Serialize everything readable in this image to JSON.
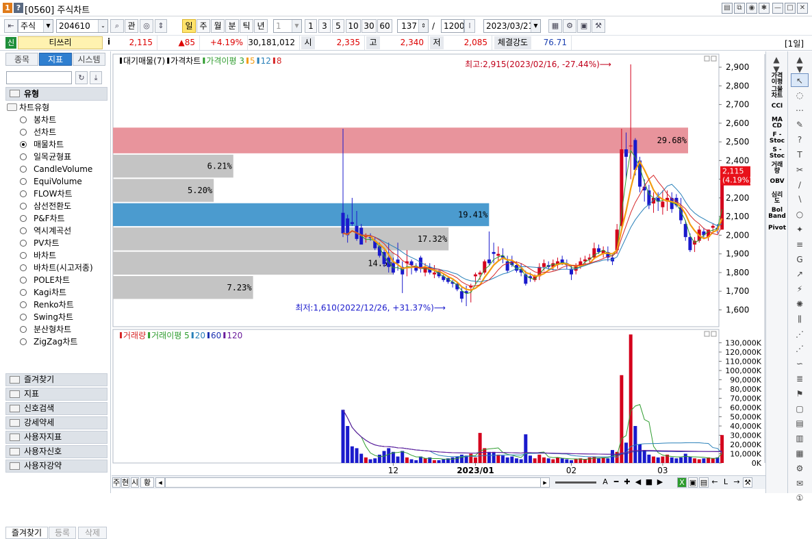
{
  "window": {
    "num": "1",
    "help": "?",
    "title": "[0560] 주식차트",
    "controls": [
      "☐",
      "☐",
      "⚙",
      "—",
      "□",
      "✕"
    ]
  },
  "toolbar": {
    "market": "주식",
    "code": "204610",
    "btn_gwan": "관",
    "periods": [
      "일",
      "주",
      "월",
      "분",
      "틱",
      "년"
    ],
    "active_period": "일",
    "n_value": "1",
    "nums": [
      "1",
      "3",
      "5",
      "10",
      "30",
      "60"
    ],
    "count": "137",
    "total": "1200",
    "date": "2023/03/21"
  },
  "quote": {
    "badge": "신",
    "name": "티쓰리",
    "info": "i",
    "price": "2,115",
    "change": "▲85",
    "pct": "+4.19%",
    "volume": "30,181,012",
    "open_label": "시",
    "open": "2,335",
    "high_label": "고",
    "high": "2,340",
    "low_label": "저",
    "low": "2,085",
    "strength_label": "체결강도",
    "strength": "76.71",
    "period_tag": "[1일]"
  },
  "sidebar": {
    "tabs": [
      "종목",
      "지표",
      "시스템"
    ],
    "active_tab": "지표",
    "section": "유형",
    "group": "차트유형",
    "items": [
      "봉차트",
      "선차트",
      "매물차트",
      "일목균형표",
      "CandleVolume",
      "EquiVolume",
      "FLOW차트",
      "삼선전환도",
      "P&F차트",
      "역시계곡선",
      "PV차트",
      "바차트",
      "바차트(시고저종)",
      "POLE차트",
      "Kagi차트",
      "Renko차트",
      "Swing차트",
      "분산형차트",
      "ZigZag차트"
    ],
    "selected": "매물차트",
    "accordion": [
      "즐겨찾기",
      "지표",
      "신호검색",
      "강세약세",
      "사용자지표",
      "사용자신호",
      "사용자강약"
    ],
    "bottom_tabs": [
      "즐겨찾기",
      "등록",
      "삭제"
    ]
  },
  "chart": {
    "legend_upper": [
      {
        "t": "대기매물(7)",
        "c": "#000"
      },
      {
        "t": "가격차트",
        "c": "#000"
      },
      {
        "t": "가격이평 3",
        "c": "#2e9c2e"
      },
      {
        "t": "5",
        "c": "#f39c12"
      },
      {
        "t": "12",
        "c": "#2980b9"
      },
      {
        "t": "8",
        "c": "#d62728"
      }
    ],
    "legend_lower": [
      {
        "t": "거래량",
        "c": "#d62728"
      },
      {
        "t": "거래이평 5",
        "c": "#2e9c2e"
      },
      {
        "t": "20",
        "c": "#2980b9"
      },
      {
        "t": "60",
        "c": "#1a2fb0"
      },
      {
        "t": "120",
        "c": "#6a1b9a"
      }
    ],
    "high_annot": "최고:2,915(2023/02/16, -27.44%)⟶",
    "low_annot": "최저:1,610(2022/12/26, +31.37%)⟶",
    "last_price": "2,115",
    "last_pct": "(4.19%)",
    "price_ticks": [
      "2,900",
      "2,800",
      "2,700",
      "2,600",
      "2,500",
      "2,400",
      "2,300",
      "2,200",
      "2,100",
      "2,000",
      "1,900",
      "1,800",
      "1,700",
      "1,600"
    ],
    "vol_ticks": [
      "130,000K",
      "120,000K",
      "110,000K",
      "100,000K",
      "90,000K",
      "80,000K",
      "70,000K",
      "60,000K",
      "50,000K",
      "40,000K",
      "30,000K",
      "20,000K",
      "10,000K",
      "0K"
    ],
    "x_ticks": [
      "12",
      "2023/01",
      "02",
      "03"
    ]
  },
  "chart_data": {
    "type": "candlestick",
    "price_range": [
      1510,
      2970
    ],
    "volume_range": [
      0,
      140000
    ],
    "volume_unit": "K",
    "volume_profile": [
      {
        "pct": "29.68%",
        "from": 2435,
        "to": 2580,
        "color": "#e8949c"
      },
      {
        "pct": "6.21%",
        "from": 2305,
        "to": 2435,
        "color": "#c4c4c4"
      },
      {
        "pct": "5.20%",
        "from": 2175,
        "to": 2305,
        "color": "#c4c4c4"
      },
      {
        "pct": "19.41%",
        "from": 2045,
        "to": 2175,
        "color": "#4b9bcf"
      },
      {
        "pct": "17.32%",
        "from": 1915,
        "to": 2045,
        "color": "#c4c4c4"
      },
      {
        "pct": "14.5%",
        "from": 1785,
        "to": 1915,
        "color": "#c4c4c4"
      },
      {
        "pct": "7.23%",
        "from": 1655,
        "to": 1785,
        "color": "#c4c4c4"
      }
    ],
    "volume_profile_share": [
      29.68,
      6.21,
      5.2,
      19.41,
      17.32,
      14.5,
      7.23
    ],
    "candles": [
      [
        2120,
        2570,
        1990,
        2010,
        57500
      ],
      [
        2090,
        2110,
        1960,
        2000,
        40000
      ],
      [
        2070,
        2200,
        2050,
        2060,
        18000
      ],
      [
        2050,
        2130,
        1970,
        1980,
        16000
      ],
      [
        2040,
        2060,
        1950,
        1950,
        10000
      ],
      [
        1990,
        2010,
        1960,
        2000,
        6000
      ],
      [
        1990,
        2010,
        1970,
        1985,
        4000
      ],
      [
        1970,
        1990,
        1920,
        1930,
        5000
      ],
      [
        1940,
        1960,
        1880,
        1890,
        9000
      ],
      [
        1910,
        1920,
        1830,
        1845,
        13000
      ],
      [
        1880,
        1960,
        1800,
        1830,
        16000
      ],
      [
        1850,
        1880,
        1790,
        1800,
        12000
      ],
      [
        1870,
        1960,
        1810,
        1850,
        7000
      ],
      [
        1830,
        1860,
        1690,
        1790,
        13000
      ],
      [
        1850,
        1920,
        1780,
        1860,
        6000
      ],
      [
        1860,
        1870,
        1790,
        1840,
        4000
      ],
      [
        1830,
        1850,
        1800,
        1810,
        3000
      ],
      [
        1880,
        1890,
        1800,
        1820,
        7000
      ],
      [
        1800,
        1850,
        1780,
        1830,
        5000
      ],
      [
        1830,
        1850,
        1790,
        1800,
        6000
      ],
      [
        1790,
        1840,
        1770,
        1800,
        3000
      ],
      [
        1810,
        1820,
        1770,
        1780,
        3000
      ],
      [
        1780,
        1790,
        1750,
        1760,
        4000
      ],
      [
        1770,
        1780,
        1740,
        1750,
        5000
      ],
      [
        1750,
        1760,
        1720,
        1740,
        6000
      ],
      [
        1740,
        1750,
        1700,
        1710,
        7000
      ],
      [
        1700,
        1720,
        1640,
        1660,
        9000
      ],
      [
        1700,
        1730,
        1620,
        1690,
        8000
      ],
      [
        1720,
        1740,
        1640,
        1730,
        10000
      ],
      [
        1780,
        1800,
        1740,
        1790,
        6000
      ],
      [
        1790,
        1810,
        1760,
        1800,
        32500
      ],
      [
        1800,
        1870,
        1790,
        1860,
        16000
      ],
      [
        1870,
        2020,
        1840,
        1850,
        12000
      ],
      [
        1910,
        1960,
        1850,
        1900,
        12000
      ],
      [
        1890,
        1940,
        1860,
        1900,
        9000
      ],
      [
        1890,
        1930,
        1850,
        1880,
        8000
      ],
      [
        1860,
        1890,
        1800,
        1810,
        6000
      ],
      [
        1860,
        1890,
        1830,
        1840,
        7000
      ],
      [
        1840,
        1860,
        1800,
        1810,
        5000
      ],
      [
        1820,
        1850,
        1780,
        1800,
        4000
      ],
      [
        1790,
        1810,
        1730,
        1740,
        31000
      ],
      [
        1780,
        1800,
        1750,
        1770,
        8000
      ],
      [
        1760,
        1790,
        1750,
        1780,
        5000
      ],
      [
        1780,
        1850,
        1760,
        1830,
        9000
      ],
      [
        1830,
        1870,
        1810,
        1850,
        6000
      ],
      [
        1840,
        1860,
        1810,
        1830,
        5000
      ],
      [
        1830,
        1870,
        1810,
        1850,
        4000
      ],
      [
        1840,
        1880,
        1820,
        1860,
        6000
      ],
      [
        1870,
        1890,
        1840,
        1850,
        5000
      ],
      [
        1850,
        1870,
        1820,
        1840,
        4000
      ],
      [
        1820,
        1840,
        1760,
        1790,
        3000
      ],
      [
        1810,
        1850,
        1790,
        1840,
        4000
      ],
      [
        1840,
        1880,
        1820,
        1860,
        5000
      ],
      [
        1860,
        1890,
        1840,
        1870,
        4000
      ],
      [
        1870,
        1900,
        1850,
        1880,
        6000
      ],
      [
        1880,
        1960,
        1870,
        1930,
        7000
      ],
      [
        1930,
        1950,
        1900,
        1910,
        5000
      ],
      [
        1900,
        1940,
        1880,
        1920,
        6000
      ],
      [
        1910,
        1940,
        1860,
        1880,
        5000
      ],
      [
        1880,
        1900,
        1840,
        1860,
        14000
      ],
      [
        1920,
        2060,
        1900,
        2030,
        12000
      ],
      [
        2050,
        2570,
        2040,
        2460,
        95000
      ],
      [
        2460,
        2550,
        2300,
        2420,
        22000
      ],
      [
        2480,
        2915,
        2300,
        2480,
        139000
      ],
      [
        2510,
        2520,
        2320,
        2350,
        40000
      ],
      [
        2400,
        2420,
        2230,
        2260,
        20000
      ],
      [
        2260,
        2300,
        2180,
        2240,
        14000
      ],
      [
        2240,
        2270,
        2140,
        2160,
        9000
      ],
      [
        2170,
        2230,
        2120,
        2200,
        7000
      ],
      [
        2200,
        2230,
        2130,
        2180,
        6000
      ],
      [
        2150,
        2240,
        2110,
        2180,
        7000
      ],
      [
        2180,
        2240,
        2130,
        2200,
        9000
      ],
      [
        2200,
        2230,
        2120,
        2140,
        6000
      ],
      [
        2200,
        2220,
        2150,
        2160,
        5000
      ],
      [
        2150,
        2200,
        2060,
        2080,
        6000
      ],
      [
        2060,
        2080,
        1970,
        1990,
        10000
      ],
      [
        1990,
        2010,
        1910,
        1920,
        7000
      ],
      [
        1950,
        1990,
        1910,
        1970,
        5000
      ],
      [
        1970,
        2050,
        1960,
        2030,
        4000
      ],
      [
        2020,
        2040,
        1980,
        2000,
        5000
      ],
      [
        1990,
        2030,
        1970,
        2030,
        6000
      ],
      [
        2040,
        2060,
        2020,
        2050,
        5000
      ],
      [
        2040,
        2060,
        2010,
        2030,
        6000
      ],
      [
        2030,
        2350,
        2030,
        2340,
        30181
      ]
    ],
    "candle_dx": 6.67,
    "x_tick_positions": [
      11,
      29,
      50,
      70
    ],
    "high": {
      "price": 2915,
      "date": "2023/02/16"
    },
    "low": {
      "price": 1610,
      "date": "2022/12/26"
    },
    "ma_price": {
      "periods": [
        3,
        5,
        12,
        8
      ],
      "colors": [
        "#2e9c2e",
        "#f39c12",
        "#2980b9",
        "#d62728"
      ]
    },
    "ma_volume": {
      "periods": [
        5,
        20,
        60,
        120
      ],
      "colors": [
        "#2e9c2e",
        "#2980b9",
        "#1a2fb0",
        "#6a1b9a"
      ]
    }
  },
  "bottombar": {
    "labels": [
      "주",
      "현",
      "시",
      "황"
    ]
  },
  "righttools": {
    "indicators": [
      "가격\n이평",
      "그물\n차트",
      "CCI",
      "MA\nCD",
      "F -\nStoc",
      "S -\nStoc",
      "거래\n량",
      "OBV",
      "심리\n도",
      "Bol\nBand",
      "Pivot"
    ]
  }
}
